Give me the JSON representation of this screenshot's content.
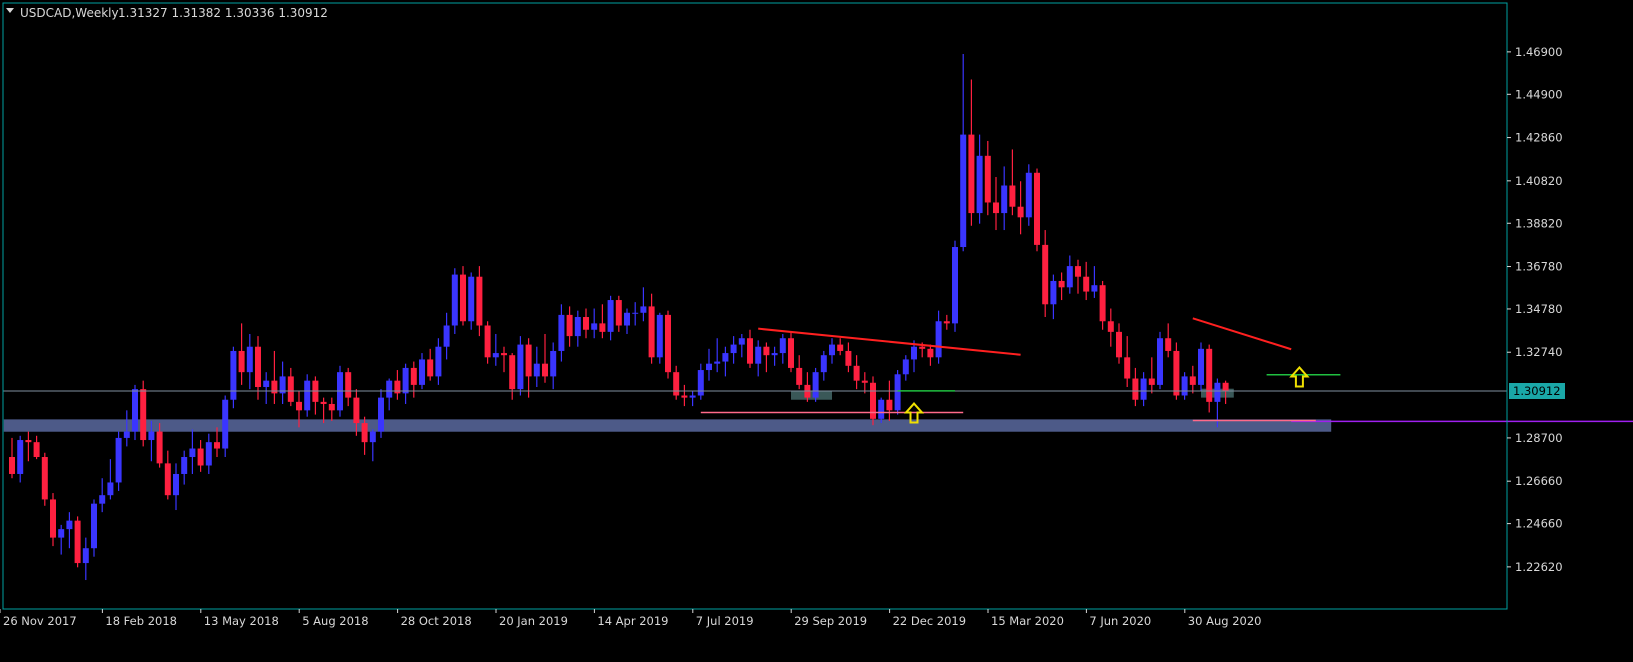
{
  "header": {
    "symbol_timeframe": "USDCAD,Weekly",
    "ohlc": "1.31327 1.31382 1.30336 1.30912"
  },
  "colors": {
    "background": "#000000",
    "frame": "#00a0a0",
    "bull_candle": "#3a35ff",
    "bear_candle": "#ff2040",
    "axis_text": "#d8d8d8",
    "current_price_line": "#8090a0",
    "current_price_box_bg": "#1aa7a7",
    "support_zone": "#5a6aa0",
    "support_line": "#a020f0",
    "trendline": "#ff2020",
    "pink_line": "#ff6a8a",
    "green_line": "#20c040",
    "gray_box": "#3a5858",
    "arrow": "#f0e000"
  },
  "chart_data": {
    "type": "candlestick",
    "symbol": "USDCAD",
    "timeframe": "Weekly",
    "current_price": "1.30912",
    "ylim": [
      1.2153,
      1.4812
    ],
    "y_ticks": [
      "1.46900",
      "1.44900",
      "1.42860",
      "1.40820",
      "1.38820",
      "1.36780",
      "1.34780",
      "1.32740",
      "1.30912",
      "1.28700",
      "1.26660",
      "1.24660",
      "1.22620"
    ],
    "x_ticks": [
      {
        "week": 0,
        "label": "26 Nov 2017"
      },
      {
        "week": 12,
        "label": "18 Feb 2018"
      },
      {
        "week": 24,
        "label": "13 May 2018"
      },
      {
        "week": 36,
        "label": "5 Aug 2018"
      },
      {
        "week": 48,
        "label": "28 Oct 2018"
      },
      {
        "week": 60,
        "label": "20 Jan 2019"
      },
      {
        "week": 72,
        "label": "14 Apr 2019"
      },
      {
        "week": 84,
        "label": "7 Jul 2019"
      },
      {
        "week": 96,
        "label": "29 Sep 2019"
      },
      {
        "week": 108,
        "label": "22 Dec 2019"
      },
      {
        "week": 120,
        "label": "15 Mar 2020"
      },
      {
        "week": 132,
        "label": "7 Jun 2020"
      },
      {
        "week": 144,
        "label": "30 Aug 2020"
      }
    ],
    "weeks_total": 156,
    "candles": [
      [
        1.278,
        1.287,
        1.268,
        1.27
      ],
      [
        1.27,
        1.288,
        1.266,
        1.286
      ],
      [
        1.286,
        1.29,
        1.276,
        1.285
      ],
      [
        1.285,
        1.288,
        1.277,
        1.278
      ],
      [
        1.278,
        1.28,
        1.255,
        1.258
      ],
      [
        1.258,
        1.261,
        1.236,
        1.24
      ],
      [
        1.24,
        1.246,
        1.232,
        1.244
      ],
      [
        1.244,
        1.252,
        1.235,
        1.248
      ],
      [
        1.248,
        1.25,
        1.226,
        1.228
      ],
      [
        1.228,
        1.24,
        1.22,
        1.235
      ],
      [
        1.235,
        1.258,
        1.231,
        1.256
      ],
      [
        1.256,
        1.268,
        1.252,
        1.26
      ],
      [
        1.26,
        1.277,
        1.258,
        1.266
      ],
      [
        1.266,
        1.29,
        1.262,
        1.287
      ],
      [
        1.287,
        1.3,
        1.283,
        1.29
      ],
      [
        1.29,
        1.312,
        1.286,
        1.31
      ],
      [
        1.31,
        1.314,
        1.283,
        1.286
      ],
      [
        1.286,
        1.295,
        1.276,
        1.29
      ],
      [
        1.29,
        1.294,
        1.273,
        1.275
      ],
      [
        1.275,
        1.281,
        1.258,
        1.26
      ],
      [
        1.26,
        1.275,
        1.253,
        1.27
      ],
      [
        1.27,
        1.281,
        1.265,
        1.278
      ],
      [
        1.278,
        1.291,
        1.27,
        1.282
      ],
      [
        1.282,
        1.286,
        1.271,
        1.274
      ],
      [
        1.274,
        1.289,
        1.27,
        1.285
      ],
      [
        1.285,
        1.292,
        1.278,
        1.282
      ],
      [
        1.282,
        1.307,
        1.278,
        1.305
      ],
      [
        1.305,
        1.33,
        1.301,
        1.328
      ],
      [
        1.328,
        1.341,
        1.312,
        1.318
      ],
      [
        1.318,
        1.336,
        1.31,
        1.33
      ],
      [
        1.33,
        1.335,
        1.305,
        1.311
      ],
      [
        1.311,
        1.318,
        1.303,
        1.314
      ],
      [
        1.314,
        1.328,
        1.303,
        1.308
      ],
      [
        1.308,
        1.323,
        1.303,
        1.316
      ],
      [
        1.316,
        1.32,
        1.302,
        1.304
      ],
      [
        1.304,
        1.309,
        1.292,
        1.3
      ],
      [
        1.3,
        1.317,
        1.297,
        1.314
      ],
      [
        1.314,
        1.316,
        1.298,
        1.304
      ],
      [
        1.304,
        1.306,
        1.294,
        1.303
      ],
      [
        1.303,
        1.306,
        1.295,
        1.3
      ],
      [
        1.3,
        1.321,
        1.297,
        1.318
      ],
      [
        1.318,
        1.32,
        1.302,
        1.306
      ],
      [
        1.306,
        1.31,
        1.288,
        1.294
      ],
      [
        1.294,
        1.297,
        1.279,
        1.285
      ],
      [
        1.285,
        1.291,
        1.276,
        1.29
      ],
      [
        1.29,
        1.31,
        1.287,
        1.306
      ],
      [
        1.306,
        1.315,
        1.3,
        1.314
      ],
      [
        1.314,
        1.319,
        1.305,
        1.308
      ],
      [
        1.308,
        1.322,
        1.303,
        1.32
      ],
      [
        1.32,
        1.323,
        1.306,
        1.312
      ],
      [
        1.312,
        1.327,
        1.31,
        1.324
      ],
      [
        1.324,
        1.329,
        1.314,
        1.316
      ],
      [
        1.316,
        1.334,
        1.312,
        1.33
      ],
      [
        1.33,
        1.346,
        1.324,
        1.34
      ],
      [
        1.34,
        1.367,
        1.336,
        1.364
      ],
      [
        1.364,
        1.368,
        1.34,
        1.342
      ],
      [
        1.342,
        1.365,
        1.338,
        1.363
      ],
      [
        1.363,
        1.368,
        1.335,
        1.34
      ],
      [
        1.34,
        1.342,
        1.322,
        1.325
      ],
      [
        1.325,
        1.336,
        1.321,
        1.327
      ],
      [
        1.327,
        1.33,
        1.318,
        1.326
      ],
      [
        1.326,
        1.327,
        1.305,
        1.31
      ],
      [
        1.31,
        1.335,
        1.307,
        1.331
      ],
      [
        1.331,
        1.334,
        1.306,
        1.316
      ],
      [
        1.316,
        1.33,
        1.311,
        1.322
      ],
      [
        1.322,
        1.336,
        1.313,
        1.316
      ],
      [
        1.316,
        1.332,
        1.31,
        1.328
      ],
      [
        1.328,
        1.35,
        1.323,
        1.345
      ],
      [
        1.345,
        1.349,
        1.33,
        1.335
      ],
      [
        1.335,
        1.347,
        1.33,
        1.344
      ],
      [
        1.344,
        1.348,
        1.334,
        1.338
      ],
      [
        1.338,
        1.348,
        1.334,
        1.341
      ],
      [
        1.341,
        1.35,
        1.334,
        1.337
      ],
      [
        1.337,
        1.354,
        1.333,
        1.352
      ],
      [
        1.352,
        1.354,
        1.337,
        1.34
      ],
      [
        1.34,
        1.348,
        1.336,
        1.346
      ],
      [
        1.346,
        1.351,
        1.34,
        1.346
      ],
      [
        1.346,
        1.358,
        1.342,
        1.349
      ],
      [
        1.349,
        1.355,
        1.322,
        1.325
      ],
      [
        1.325,
        1.346,
        1.322,
        1.345
      ],
      [
        1.345,
        1.347,
        1.315,
        1.318
      ],
      [
        1.318,
        1.321,
        1.305,
        1.307
      ],
      [
        1.307,
        1.312,
        1.302,
        1.306
      ],
      [
        1.306,
        1.309,
        1.302,
        1.307
      ],
      [
        1.307,
        1.322,
        1.305,
        1.319
      ],
      [
        1.319,
        1.329,
        1.314,
        1.322
      ],
      [
        1.322,
        1.334,
        1.318,
        1.323
      ],
      [
        1.323,
        1.33,
        1.316,
        1.327
      ],
      [
        1.327,
        1.335,
        1.322,
        1.331
      ],
      [
        1.331,
        1.336,
        1.325,
        1.334
      ],
      [
        1.334,
        1.338,
        1.32,
        1.322
      ],
      [
        1.322,
        1.333,
        1.316,
        1.33
      ],
      [
        1.33,
        1.332,
        1.318,
        1.326
      ],
      [
        1.326,
        1.33,
        1.321,
        1.327
      ],
      [
        1.327,
        1.336,
        1.322,
        1.334
      ],
      [
        1.334,
        1.337,
        1.318,
        1.32
      ],
      [
        1.32,
        1.326,
        1.31,
        1.312
      ],
      [
        1.312,
        1.318,
        1.304,
        1.306
      ],
      [
        1.306,
        1.32,
        1.304,
        1.318
      ],
      [
        1.318,
        1.328,
        1.314,
        1.326
      ],
      [
        1.326,
        1.334,
        1.322,
        1.331
      ],
      [
        1.331,
        1.334,
        1.326,
        1.328
      ],
      [
        1.328,
        1.332,
        1.318,
        1.321
      ],
      [
        1.321,
        1.326,
        1.31,
        1.314
      ],
      [
        1.314,
        1.318,
        1.308,
        1.313
      ],
      [
        1.313,
        1.316,
        1.293,
        1.296
      ],
      [
        1.296,
        1.306,
        1.294,
        1.305
      ],
      [
        1.305,
        1.314,
        1.295,
        1.3
      ],
      [
        1.3,
        1.319,
        1.298,
        1.317
      ],
      [
        1.317,
        1.326,
        1.314,
        1.324
      ],
      [
        1.324,
        1.333,
        1.318,
        1.33
      ],
      [
        1.33,
        1.332,
        1.325,
        1.329
      ],
      [
        1.329,
        1.331,
        1.321,
        1.325
      ],
      [
        1.325,
        1.347,
        1.322,
        1.342
      ],
      [
        1.342,
        1.345,
        1.338,
        1.341
      ],
      [
        1.341,
        1.38,
        1.337,
        1.377
      ],
      [
        1.377,
        1.468,
        1.375,
        1.43
      ],
      [
        1.43,
        1.456,
        1.387,
        1.393
      ],
      [
        1.393,
        1.43,
        1.388,
        1.42
      ],
      [
        1.42,
        1.427,
        1.392,
        1.398
      ],
      [
        1.398,
        1.41,
        1.385,
        1.393
      ],
      [
        1.393,
        1.415,
        1.385,
        1.406
      ],
      [
        1.406,
        1.423,
        1.392,
        1.396
      ],
      [
        1.396,
        1.408,
        1.383,
        1.391
      ],
      [
        1.391,
        1.416,
        1.387,
        1.412
      ],
      [
        1.412,
        1.414,
        1.375,
        1.378
      ],
      [
        1.378,
        1.385,
        1.344,
        1.35
      ],
      [
        1.35,
        1.364,
        1.343,
        1.361
      ],
      [
        1.361,
        1.365,
        1.352,
        1.358
      ],
      [
        1.358,
        1.373,
        1.355,
        1.368
      ],
      [
        1.368,
        1.371,
        1.355,
        1.363
      ],
      [
        1.363,
        1.37,
        1.352,
        1.356
      ],
      [
        1.356,
        1.368,
        1.353,
        1.359
      ],
      [
        1.359,
        1.361,
        1.338,
        1.342
      ],
      [
        1.342,
        1.348,
        1.33,
        1.337
      ],
      [
        1.337,
        1.341,
        1.322,
        1.325
      ],
      [
        1.325,
        1.335,
        1.311,
        1.315
      ],
      [
        1.315,
        1.32,
        1.302,
        1.305
      ],
      [
        1.305,
        1.318,
        1.302,
        1.315
      ],
      [
        1.315,
        1.325,
        1.308,
        1.312
      ],
      [
        1.312,
        1.337,
        1.31,
        1.334
      ],
      [
        1.334,
        1.341,
        1.325,
        1.328
      ],
      [
        1.328,
        1.332,
        1.305,
        1.307
      ],
      [
        1.307,
        1.318,
        1.305,
        1.316
      ],
      [
        1.316,
        1.321,
        1.308,
        1.312
      ],
      [
        1.312,
        1.332,
        1.309,
        1.329
      ],
      [
        1.329,
        1.331,
        1.299,
        1.304
      ],
      [
        1.304,
        1.315,
        1.292,
        1.313
      ],
      [
        1.313,
        1.314,
        1.303,
        1.309
      ]
    ],
    "annotations": [
      {
        "type": "zone",
        "label": "support zone",
        "y": [
          1.2918,
          1.2948
        ],
        "x_weeks": [
          -1,
          156
        ]
      },
      {
        "type": "hline",
        "label": "support line",
        "y": 1.2948,
        "x_weeks": [
          156,
          168
        ]
      },
      {
        "type": "hline",
        "label": "current price line",
        "y": 1.30912
      },
      {
        "type": "trendline",
        "label": "descending trendline 2019",
        "from": [
          91,
          1.3385
        ],
        "to": [
          123,
          1.3262
        ]
      },
      {
        "type": "trendline",
        "label": "descending trendline 2020",
        "from": [
          144,
          1.3434
        ],
        "to": [
          156,
          1.3288
        ]
      },
      {
        "type": "hline",
        "label": "pink support 2019",
        "y": 1.299,
        "x_weeks": [
          84,
          116
        ]
      },
      {
        "type": "hline",
        "label": "pink support 2020",
        "y": 1.2952,
        "x_weeks": [
          144,
          159
        ]
      },
      {
        "type": "hline",
        "label": "green level 2019",
        "y": 1.3092,
        "x_weeks": [
          108,
          115
        ]
      },
      {
        "type": "hline",
        "label": "green level 2020",
        "y": 1.3168,
        "x_weeks": [
          153,
          162
        ]
      },
      {
        "type": "box",
        "label": "gray box 2019",
        "y": [
          1.305,
          1.3092
        ],
        "x_weeks": [
          95,
          100
        ]
      },
      {
        "type": "box",
        "label": "gray box 2020",
        "y": [
          1.306,
          1.3102
        ],
        "x_weeks": [
          145,
          149
        ]
      },
      {
        "type": "arrow-up",
        "label": "buy arrow 2019",
        "at": [
          110,
          1.2985
        ]
      },
      {
        "type": "arrow-up",
        "label": "buy arrow 2020",
        "at": [
          157,
          1.3155
        ]
      }
    ]
  }
}
